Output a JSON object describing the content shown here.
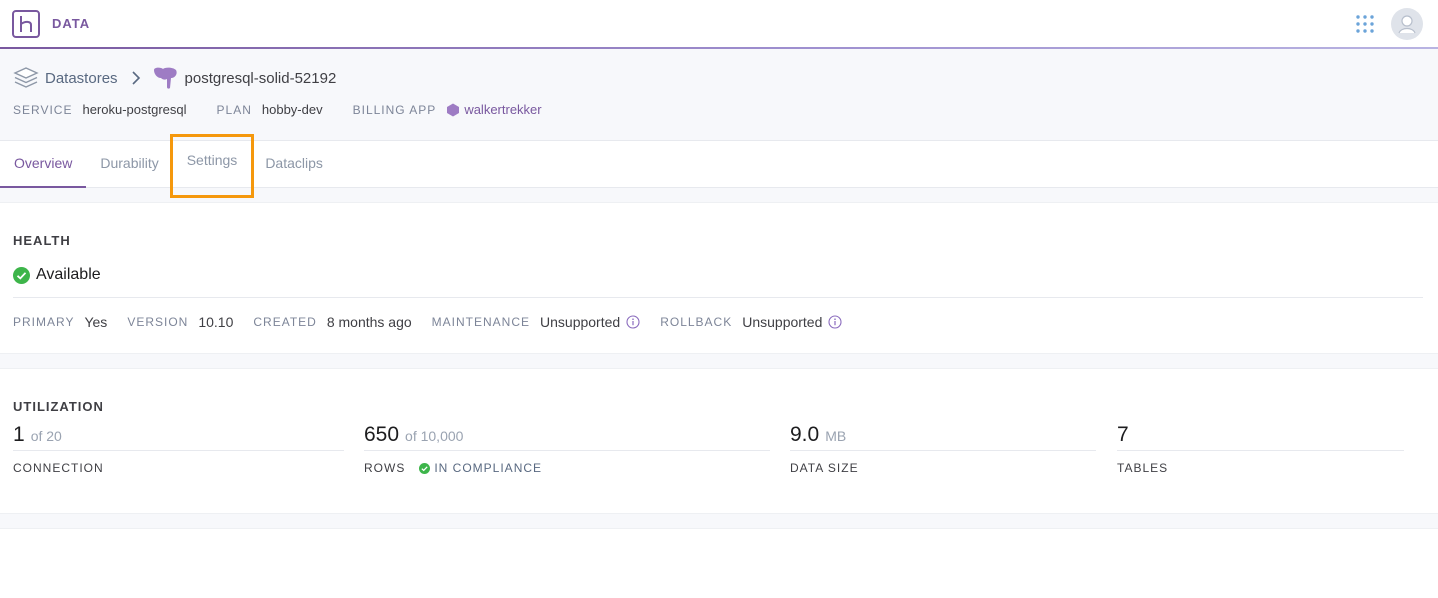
{
  "topbar": {
    "brand_label": "DATA",
    "brand_logo_icon": "heroku-logo-icon",
    "apps_icon": "apps-grid-icon",
    "avatar_icon": "user-avatar-icon"
  },
  "header": {
    "breadcrumb_root": "Datastores",
    "database_name": "postgresql-solid-52192",
    "meta": [
      {
        "label": "SERVICE",
        "value": "heroku-postgresql"
      },
      {
        "label": "PLAN",
        "value": "hobby-dev"
      },
      {
        "label": "BILLING APP",
        "value": "walkertrekker"
      }
    ]
  },
  "tabs": [
    {
      "label": "Overview",
      "active": true
    },
    {
      "label": "Durability",
      "active": false
    },
    {
      "label": "Settings",
      "active": false,
      "highlighted": true
    },
    {
      "label": "Dataclips",
      "active": false
    }
  ],
  "health": {
    "title": "HEALTH",
    "status": "Available",
    "props": [
      {
        "label": "PRIMARY",
        "value": "Yes"
      },
      {
        "label": "VERSION",
        "value": "10.10"
      },
      {
        "label": "CREATED",
        "value": "8 months ago"
      },
      {
        "label": "MAINTENANCE",
        "value": "Unsupported",
        "info": true
      },
      {
        "label": "ROLLBACK",
        "value": "Unsupported",
        "info": true
      }
    ]
  },
  "utilization": {
    "title": "UTILIZATION",
    "stats": [
      {
        "value": "1",
        "suffix": "of 20",
        "caption": "CONNECTION"
      },
      {
        "value": "650",
        "suffix": "of 10,000",
        "caption": "ROWS",
        "badge": "IN COMPLIANCE"
      },
      {
        "value": "9.0",
        "suffix": "MB",
        "caption": "DATA SIZE"
      },
      {
        "value": "7",
        "suffix": "",
        "caption": "TABLES"
      }
    ]
  },
  "colors": {
    "accent": "#79589f",
    "highlight": "#f5980c",
    "success": "#3db54a"
  }
}
